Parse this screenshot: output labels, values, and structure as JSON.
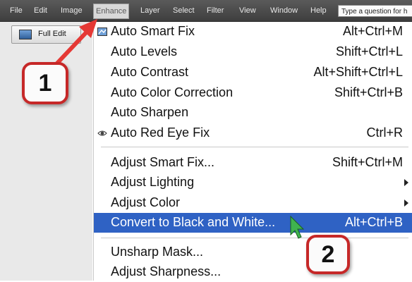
{
  "menubar": {
    "items": [
      "File",
      "Edit",
      "Image",
      "Enhance",
      "Layer",
      "Select",
      "Filter",
      "View",
      "Window",
      "Help"
    ],
    "search_placeholder": "Type a question for h"
  },
  "toolbar": {
    "full_edit_label": "Full Edit"
  },
  "enhance_menu": {
    "items": [
      {
        "label": "Auto Smart Fix",
        "shortcut": "Alt+Ctrl+M",
        "icon": "smart-fix-icon"
      },
      {
        "label": "Auto Levels",
        "shortcut": "Shift+Ctrl+L"
      },
      {
        "label": "Auto Contrast",
        "shortcut": "Alt+Shift+Ctrl+L"
      },
      {
        "label": "Auto Color Correction",
        "shortcut": "Shift+Ctrl+B"
      },
      {
        "label": "Auto Sharpen",
        "shortcut": ""
      },
      {
        "label": "Auto Red Eye Fix",
        "shortcut": "Ctrl+R",
        "icon": "eye-icon"
      },
      {
        "label": "Adjust Smart Fix...",
        "shortcut": "Shift+Ctrl+M"
      },
      {
        "label": "Adjust Lighting",
        "shortcut": "",
        "submenu": true
      },
      {
        "label": "Adjust Color",
        "shortcut": "",
        "submenu": true
      },
      {
        "label": "Convert to Black and White...",
        "shortcut": "Alt+Ctrl+B",
        "highlighted": true
      },
      {
        "label": "Unsharp Mask...",
        "shortcut": ""
      },
      {
        "label": "Adjust Sharpness...",
        "shortcut": ""
      }
    ]
  },
  "annotations": {
    "step1": "1",
    "step2": "2"
  },
  "colors": {
    "highlight": "#2f62c4",
    "callout_border": "#c62828",
    "arrow": "#e53935",
    "cursor": "#3fb34f"
  }
}
